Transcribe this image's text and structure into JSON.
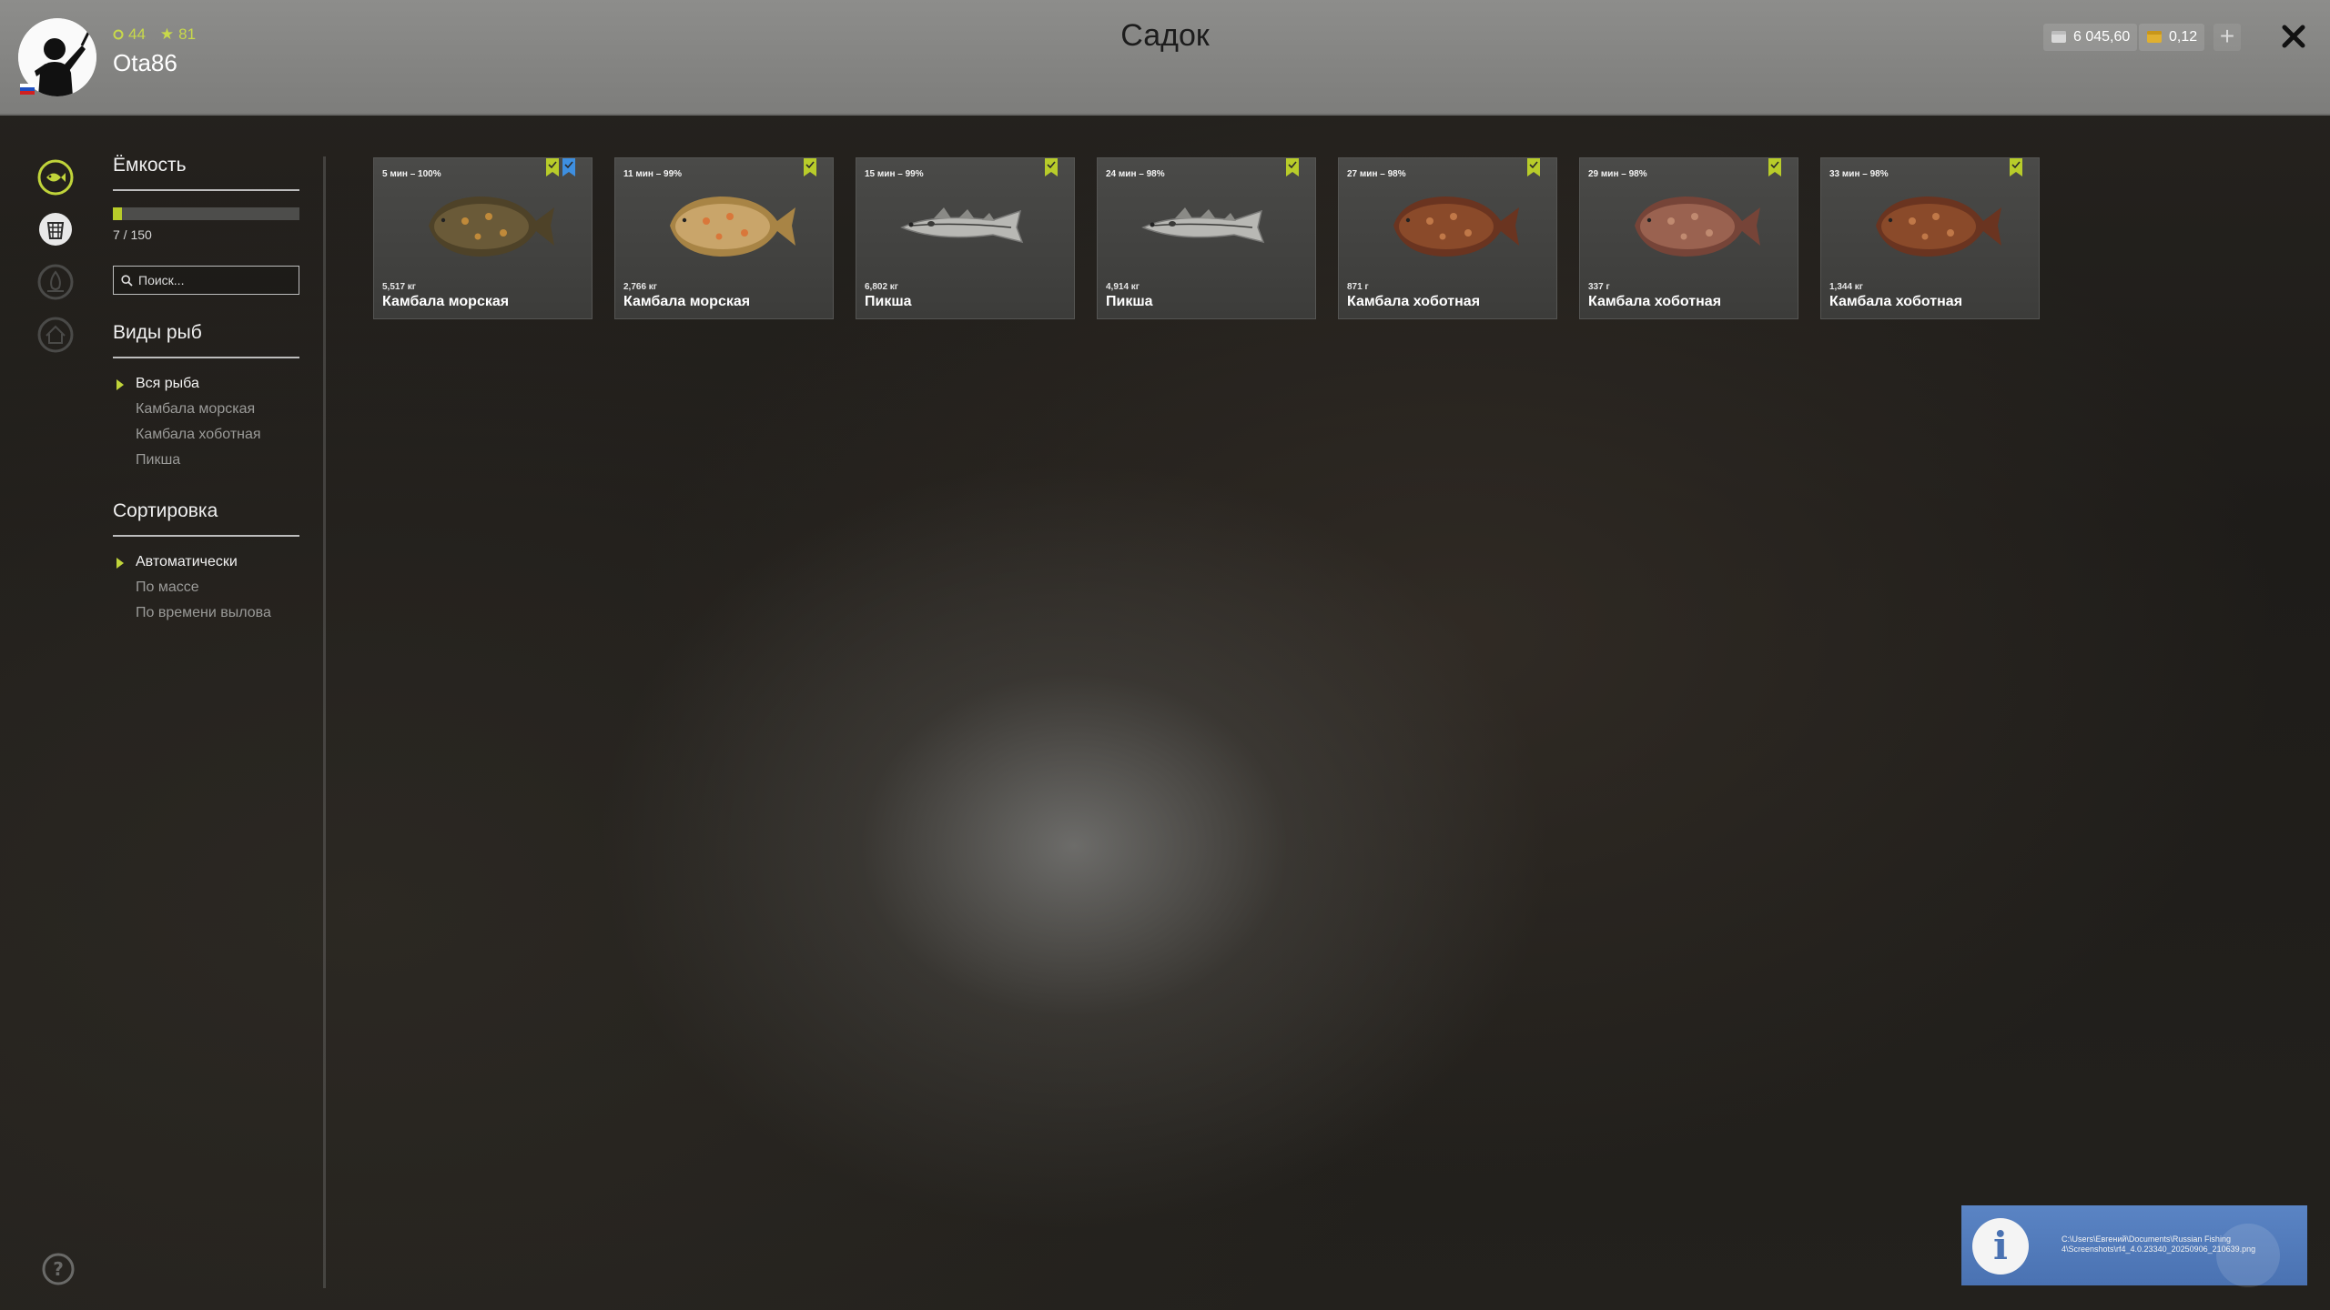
{
  "header": {
    "title": "Садок",
    "username": "Ota86",
    "level": "44",
    "rank": "81",
    "silver": "6 045,60",
    "gold": "0,12",
    "plus_label": "+"
  },
  "sidebar": {
    "capacity_title": "Ёмкость",
    "capacity_text": "7 / 150",
    "capacity_used": 7,
    "capacity_max": 150,
    "search_placeholder": "Поиск...",
    "species_title": "Виды рыб",
    "species": [
      "Вся рыба",
      "Камбала морская",
      "Камбала хоботная",
      "Пикша"
    ],
    "sort_title": "Сортировка",
    "sort_options": [
      "Автоматически",
      "По массе",
      "По времени вылова"
    ]
  },
  "fish": [
    {
      "time": "5 мин – 100%",
      "weight": "5,517 кг",
      "name": "Камбала морская",
      "kind": "plaice-dark",
      "badges": [
        "green",
        "blue"
      ]
    },
    {
      "time": "11 мин – 99%",
      "weight": "2,766 кг",
      "name": "Камбала морская",
      "kind": "plaice-light",
      "badges": [
        "green"
      ]
    },
    {
      "time": "15 мин – 99%",
      "weight": "6,802 кг",
      "name": "Пикша",
      "kind": "haddock",
      "badges": [
        "green"
      ]
    },
    {
      "time": "24 мин – 98%",
      "weight": "4,914 кг",
      "name": "Пикша",
      "kind": "haddock",
      "badges": [
        "green"
      ]
    },
    {
      "time": "27 мин – 98%",
      "weight": "871 г",
      "name": "Камбала хоботная",
      "kind": "dab",
      "badges": [
        "green"
      ]
    },
    {
      "time": "29 мин – 98%",
      "weight": "337 г",
      "name": "Камбала хоботная",
      "kind": "dab-pale",
      "badges": [
        "green"
      ]
    },
    {
      "time": "33 мин – 98%",
      "weight": "1,344 кг",
      "name": "Камбала хоботная",
      "kind": "dab",
      "badges": [
        "green"
      ]
    }
  ],
  "notification": {
    "path": "C:\\Users\\Евгений\\Documents\\Russian Fishing 4\\Screenshots\\rf4_4.0.23340_20250906_210639.png"
  },
  "colors": {
    "accent": "#c0d43a",
    "badge_green": "#b8cc2a",
    "badge_blue": "#3e8fe0",
    "toast": "#4a72b2"
  }
}
